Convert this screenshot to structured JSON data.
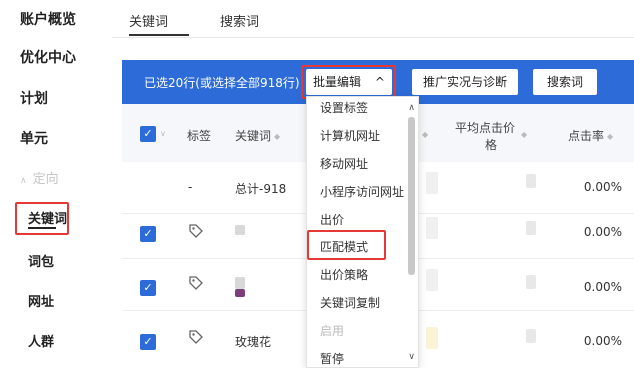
{
  "sidebar": {
    "overview": "账户概览",
    "optimize": "优化中心",
    "plan": "计划",
    "unit": "单元",
    "targeting": "定向",
    "keyword": "关键词",
    "wordpack": "词包",
    "url": "网址",
    "audience": "人群"
  },
  "tabs": {
    "keyword": "关键词",
    "search": "搜索词"
  },
  "toolbar": {
    "selection": "已选20行(或选择全部918行)",
    "batch_edit": "批量编辑",
    "batch_caret": "^",
    "diagnose": "推广实况与诊断",
    "search_words": "搜索词"
  },
  "table": {
    "headers": {
      "tag": "标签",
      "keyword": "关键词",
      "avg_cpc_line1": "平均点击价",
      "avg_cpc_line2": "格",
      "ctr": "点击率"
    },
    "rows": [
      {
        "tag": "-",
        "keyword": "总计-918",
        "ctr": "0.00%"
      },
      {
        "keyword": "",
        "ctr": "0.00%"
      },
      {
        "keyword": "",
        "ctr": "0.00%"
      },
      {
        "keyword": "玫瑰花",
        "ctr": "0.00%"
      }
    ]
  },
  "dropdown": {
    "items": [
      "设置标签",
      "计算机网址",
      "移动网址",
      "小程序访问网址",
      "出价",
      "匹配模式",
      "出价策略",
      "关键词复制",
      "启用",
      "暂停"
    ],
    "disabled": "启用"
  },
  "colors": {
    "accent": "#2d6bd8",
    "highlight": "#e53935"
  }
}
